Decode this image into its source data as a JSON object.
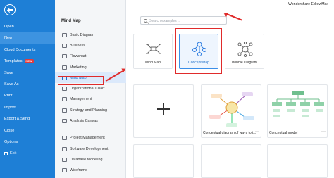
{
  "app": {
    "brand": "Wondershare EdrawMax"
  },
  "sidebar": {
    "items": [
      {
        "label": "Open"
      },
      {
        "label": "New"
      },
      {
        "label": "Cloud Documents"
      },
      {
        "label": "Templates",
        "badge": "NEW"
      },
      {
        "label": "Save"
      },
      {
        "label": "Save As"
      },
      {
        "label": "Print"
      },
      {
        "label": "Import"
      },
      {
        "label": "Export & Send"
      },
      {
        "label": "Close"
      },
      {
        "label": "Options"
      },
      {
        "label": "Exit"
      }
    ],
    "active_index": 1
  },
  "categories": {
    "title": "Mind Map",
    "items": [
      "Basic Diagram",
      "Business",
      "Flowchart",
      "Marketing",
      "Mind Map",
      "Organizational Chart",
      "Management",
      "Strategy and Planning",
      "Analysis Canvas",
      "Project Management",
      "Software Development",
      "Database Modeling",
      "Wireframe"
    ],
    "selected": "Mind Map"
  },
  "search": {
    "placeholder": "Search examples ..."
  },
  "templates": [
    {
      "label": "Mind Map",
      "icon": "mind-map-icon"
    },
    {
      "label": "Concept Map",
      "icon": "concept-map-icon",
      "selected": true
    },
    {
      "label": "Bubble Diagram",
      "icon": "bubble-diagram-icon"
    }
  ],
  "examples": [
    {
      "caption": "Conceptual diagram of ways to i..."
    },
    {
      "caption": "Conceptual model"
    }
  ],
  "colors": {
    "sidebar": "#1e7fd6",
    "highlight": "#e02b2b",
    "accent": "#1e6fc8"
  }
}
